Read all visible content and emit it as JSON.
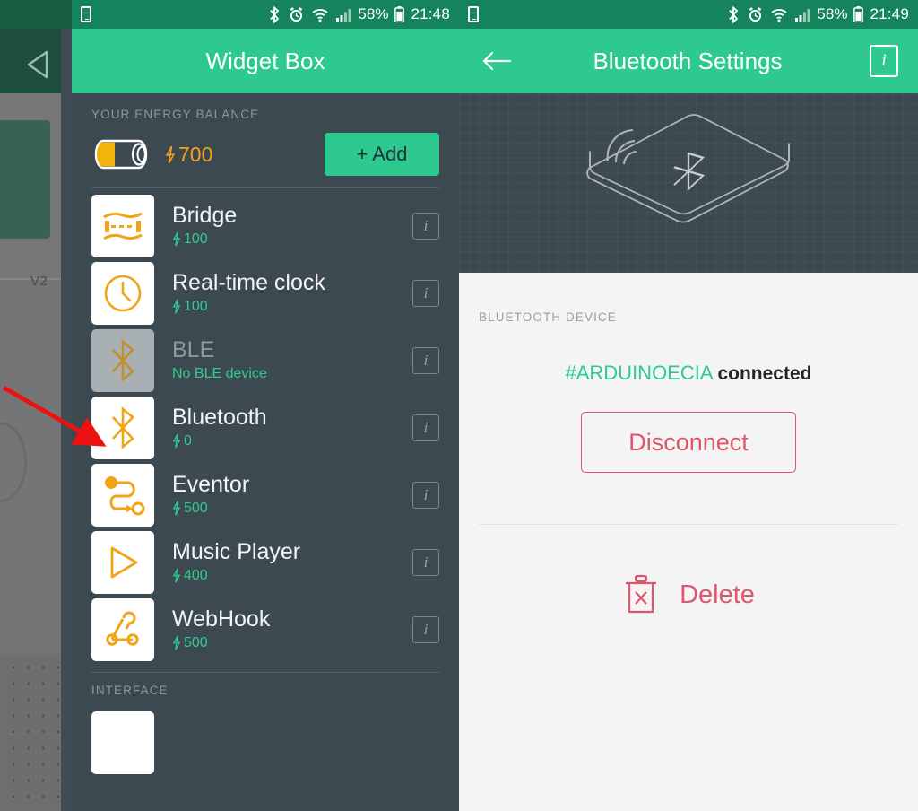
{
  "left": {
    "statusbar": {
      "icons": [
        "phone-icon",
        "bluetooth-icon",
        "alarm-icon",
        "wifi-icon",
        "signal-icon",
        "battery-icon"
      ],
      "battery_percent": "58%",
      "time": "21:48"
    },
    "appbar": {
      "title": "Widget Box",
      "back_icon": "back-triangle-icon"
    },
    "energy": {
      "section_label": "YOUR ENERGY BALANCE",
      "value": "700",
      "bolt": "⚡",
      "add_label": "+ Add"
    },
    "widgets": [
      {
        "name": "Bridge",
        "cost": "100",
        "icon": "bridge-icon",
        "disabled": false,
        "info": "i"
      },
      {
        "name": "Real-time clock",
        "cost": "100",
        "icon": "clock-icon",
        "disabled": false,
        "info": "i"
      },
      {
        "name": "BLE",
        "cost": "No BLE device",
        "icon": "bluetooth-icon",
        "disabled": true,
        "info": "i"
      },
      {
        "name": "Bluetooth",
        "cost": "0",
        "icon": "bluetooth-icon",
        "disabled": false,
        "info": "i"
      },
      {
        "name": "Eventor",
        "cost": "500",
        "icon": "eventor-icon",
        "disabled": false,
        "info": "i"
      },
      {
        "name": "Music Player",
        "cost": "400",
        "icon": "play-icon",
        "disabled": false,
        "info": "i"
      },
      {
        "name": "WebHook",
        "cost": "500",
        "icon": "webhook-icon",
        "disabled": false,
        "info": "i"
      }
    ],
    "interface_label": "INTERFACE"
  },
  "right": {
    "statusbar": {
      "battery_percent": "58%",
      "time": "21:49"
    },
    "appbar": {
      "title": "Bluetooth Settings",
      "back_icon": "back-arrow-icon",
      "info": "i"
    },
    "hero_icon": "bluetooth-device-illustration",
    "section_label": "BLUETOOTH DEVICE",
    "device_name": "#ARDUINOECIA",
    "device_status": "connected",
    "disconnect_label": "Disconnect",
    "delete_label": "Delete",
    "delete_icon": "trash-x-icon"
  },
  "background_app": {
    "label": "V2"
  },
  "colors": {
    "accent_green": "#2ec98e",
    "statusbar_green": "#15845c",
    "panel_dark": "#3c4950",
    "orange": "#f0a417",
    "red": "#e0556e",
    "annotation_red": "#ee1111"
  }
}
